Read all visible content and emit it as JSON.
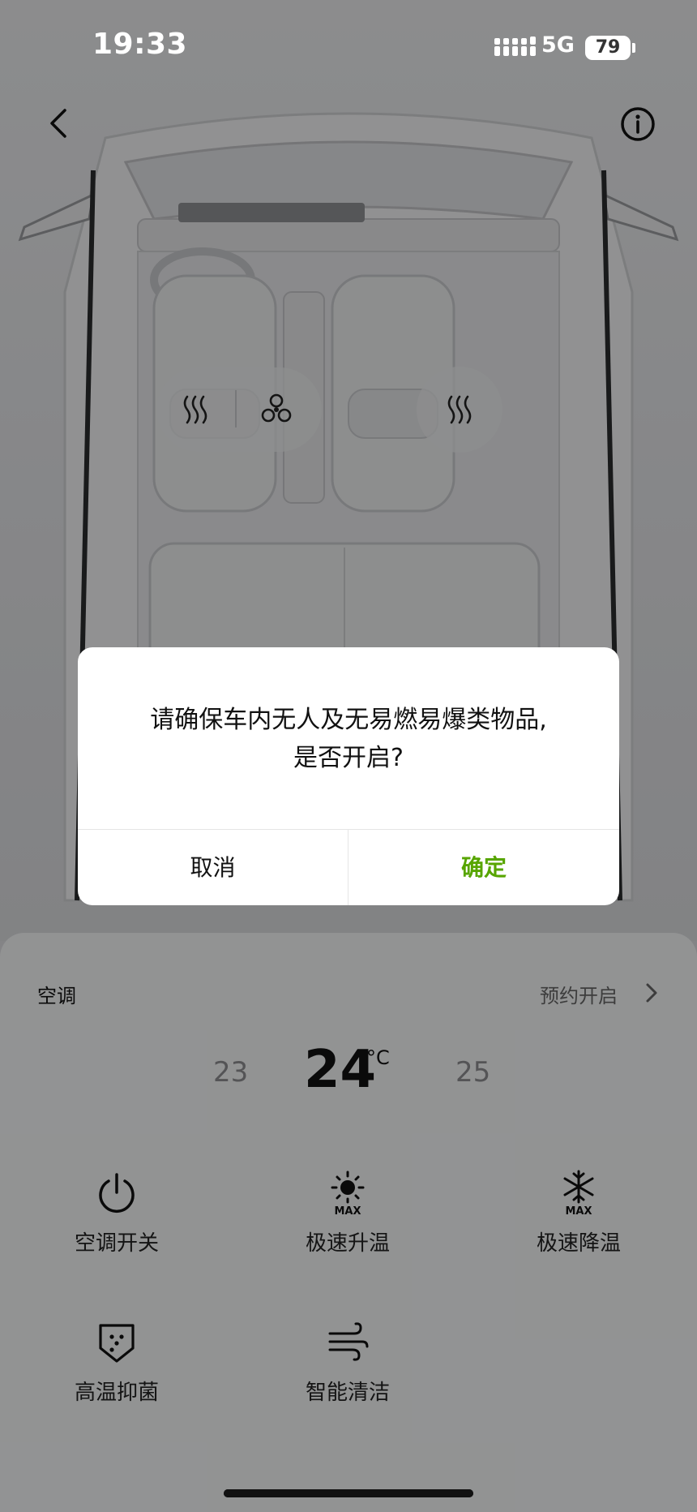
{
  "status_bar": {
    "time": "19:33",
    "network": "5G",
    "battery": "79"
  },
  "car_view": {
    "back_icon": "chevron-left-icon",
    "info_icon": "info-icon",
    "driver_seat_controls": [
      "seat-heat-icon",
      "seat-ventilation-icon"
    ],
    "passenger_seat_controls": [
      "seat-heat-icon"
    ]
  },
  "ac_panel": {
    "title": "空调",
    "schedule_label": "预约开启",
    "temperature": {
      "previous": "23",
      "current": "24",
      "unit": "°C",
      "next": "25"
    },
    "functions": [
      {
        "label": "空调开关",
        "icon": "power-icon"
      },
      {
        "label": "极速升温",
        "icon": "sun-max-icon"
      },
      {
        "label": "极速降温",
        "icon": "snowflake-max-icon"
      },
      {
        "label": "高温抑菌",
        "icon": "shield-dots-icon"
      },
      {
        "label": "智能清洁",
        "icon": "wind-icon"
      }
    ]
  },
  "dialog": {
    "message_line1": "请确保车内无人及无易燃易爆类物品,",
    "message_line2": "是否开启?",
    "cancel_label": "取消",
    "confirm_label": "确定"
  },
  "colors": {
    "confirm": "#57a500",
    "overlay": "rgba(0,0,0,0.40)"
  }
}
